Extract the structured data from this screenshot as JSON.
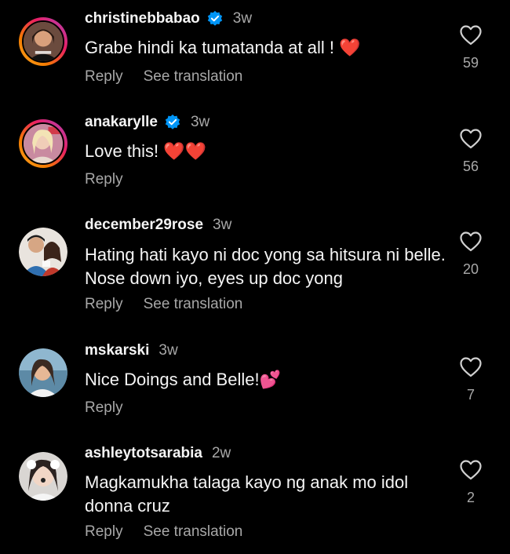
{
  "comments": [
    {
      "username": "christinebbabao",
      "verified": true,
      "time": "3w",
      "text": "Grabe hindi ka tumatanda at all ! ❤️",
      "likes": "59",
      "reply_label": "Reply",
      "translate_label": "See translation"
    },
    {
      "username": "anakarylle",
      "verified": true,
      "time": "3w",
      "text": "Love this! ❤️❤️",
      "likes": "56",
      "reply_label": "Reply"
    },
    {
      "username": "december29rose",
      "verified": false,
      "time": "3w",
      "text": "Hating hati kayo ni doc yong sa hitsura ni belle. Nose down iyo, eyes up doc yong",
      "likes": "20",
      "reply_label": "Reply",
      "translate_label": "See translation"
    },
    {
      "username": "mskarski",
      "verified": false,
      "time": "3w",
      "text": "Nice Doings and Belle!💕",
      "likes": "7",
      "reply_label": "Reply"
    },
    {
      "username": "ashleytotsarabia",
      "verified": false,
      "time": "2w",
      "text": "Magkamukha talaga kayo ng anak mo idol donna cruz",
      "likes": "2",
      "reply_label": "Reply",
      "translate_label": "See translation"
    }
  ],
  "colors": {
    "background": "#000000",
    "primary_text": "#f5f5f5",
    "secondary_text": "#a8a8a8",
    "verified_blue": "#0095f6",
    "heart_red": "#e0245e"
  },
  "icons": {
    "like": "heart-outline-icon",
    "verified": "verified-badge-icon"
  }
}
